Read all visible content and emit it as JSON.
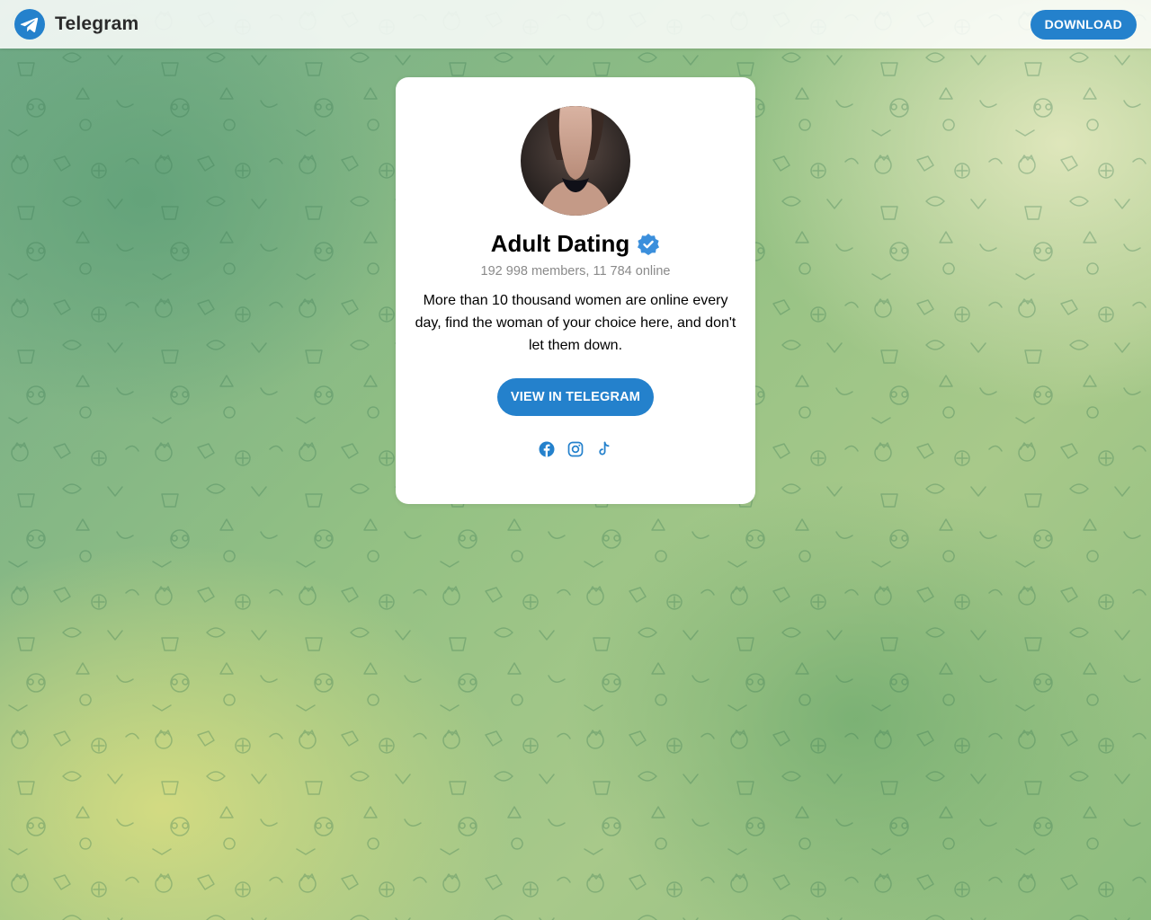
{
  "header": {
    "logo_text": "Telegram",
    "download_label": "DOWNLOAD"
  },
  "channel": {
    "title": "Adult Dating",
    "members": "192 998 members, 11 784 online",
    "description": "More than 10 thousand women are online every day, find the woman of your choice here, and don't let them down.",
    "view_button_label": "VIEW IN TELEGRAM"
  },
  "icons": {
    "logo": "telegram-logo-icon",
    "verified": "verified-badge-icon",
    "socials": [
      "facebook-icon",
      "instagram-icon",
      "tiktok-icon"
    ]
  },
  "colors": {
    "accent": "#2481cc",
    "card": "#ffffff",
    "muted_text": "#8a8a8a"
  }
}
